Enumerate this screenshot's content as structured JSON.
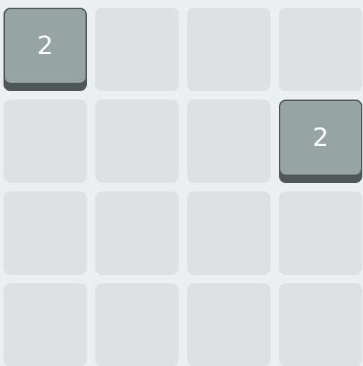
{
  "board": {
    "tiles": [
      {
        "row": 0,
        "col": 0,
        "value": "2"
      },
      {
        "row": 1,
        "col": 3,
        "value": "2"
      }
    ]
  },
  "theme": {
    "background": "#ebeff0",
    "empty_cell": "#dee1e4",
    "tile_2": "#96a5a3",
    "tile_border": "#4f5758",
    "tile_text": "#ffffff"
  }
}
